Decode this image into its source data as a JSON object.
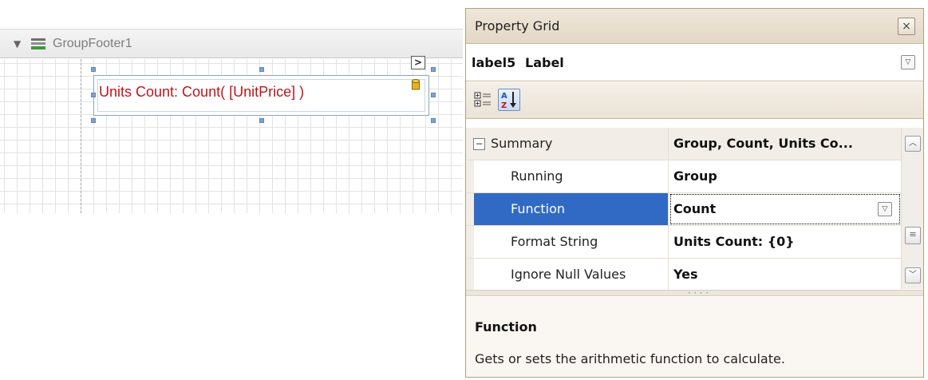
{
  "designer": {
    "band_title": "GroupFooter1",
    "label_text": "Units Count: Count( [UnitPrice] )",
    "smart_tag_glyph": ">",
    "label_color": "#c0141d"
  },
  "property_grid": {
    "title": "Property Grid",
    "close_glyph": "×",
    "selected_object": {
      "name": "label5",
      "type": "Label"
    },
    "toolbar": [
      "categorized-view",
      "alphabetical-view"
    ],
    "rows": [
      {
        "name": "Summary",
        "value": "Group, Count, Units Co...",
        "kind": "category",
        "expander": "−"
      },
      {
        "name": "Running",
        "value": "Group"
      },
      {
        "name": "Function",
        "value": "Count",
        "selected": true
      },
      {
        "name": "Format String",
        "value": "Units Count: {0}"
      },
      {
        "name": "Ignore Null Values",
        "value": "Yes"
      }
    ],
    "description": {
      "title": "Function",
      "text": "Gets or sets the arithmetic function to calculate."
    },
    "selection_color": "#316ac5"
  }
}
